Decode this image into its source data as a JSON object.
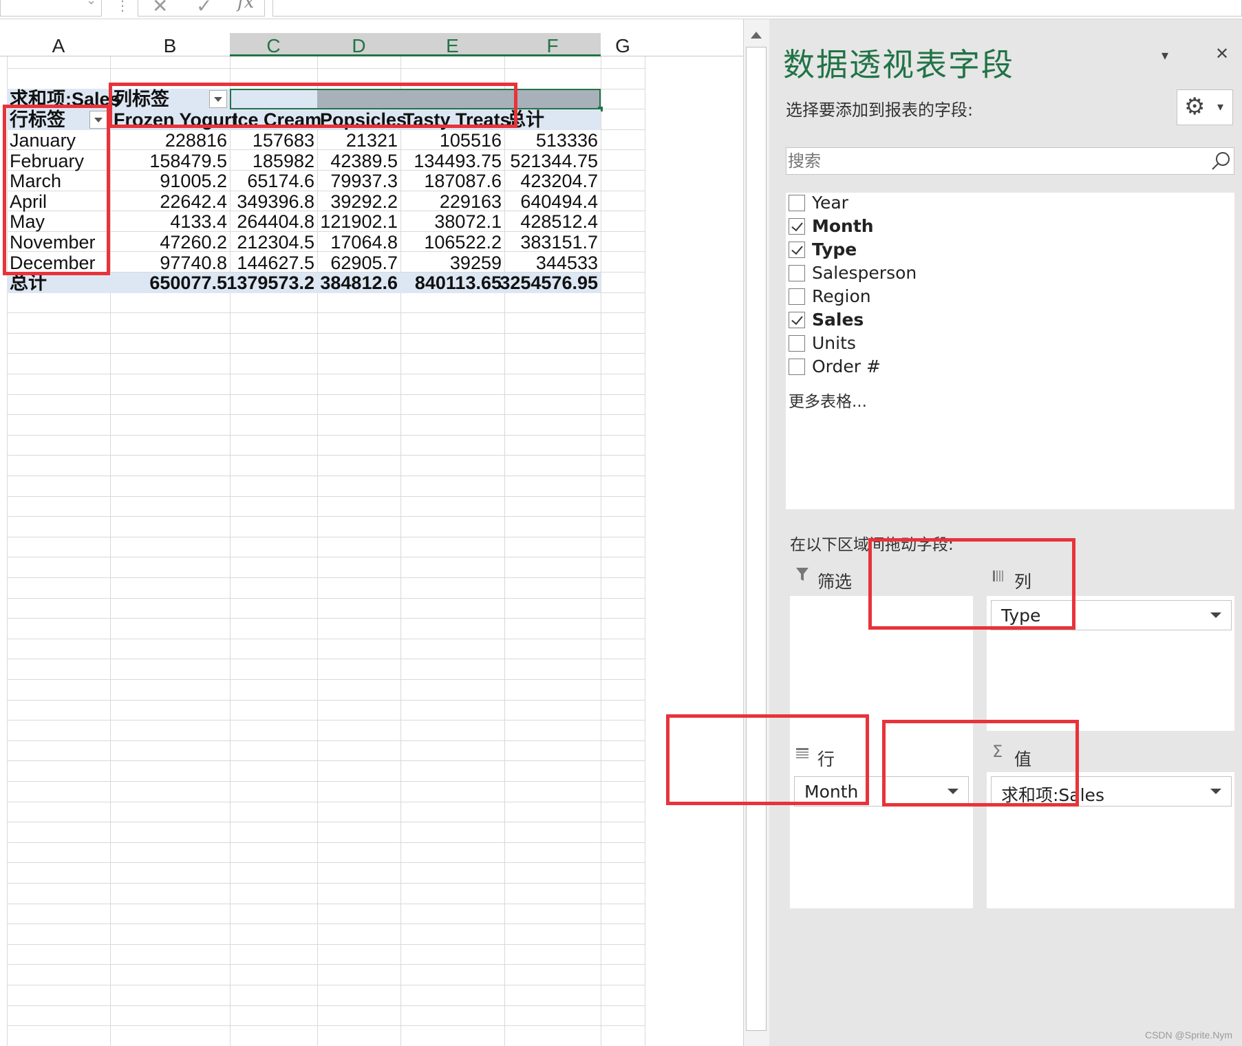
{
  "formula_bar": {
    "fx_label": "fx"
  },
  "columns": [
    "A",
    "B",
    "C",
    "D",
    "E",
    "F",
    "G"
  ],
  "pivot": {
    "values_label": "求和项:Sales",
    "column_labels": "列标签",
    "row_labels": "行标签",
    "col_headers": [
      "Frozen Yogurt",
      "Ice Cream",
      "Popsicles",
      "Tasty Treats",
      "总计"
    ],
    "rows": [
      {
        "label": "January",
        "values": [
          "228816",
          "157683",
          "21321",
          "105516",
          "513336"
        ]
      },
      {
        "label": "February",
        "values": [
          "158479.5",
          "185982",
          "42389.5",
          "134493.75",
          "521344.75"
        ]
      },
      {
        "label": "March",
        "values": [
          "91005.2",
          "65174.6",
          "79937.3",
          "187087.6",
          "423204.7"
        ]
      },
      {
        "label": "April",
        "values": [
          "22642.4",
          "349396.8",
          "39292.2",
          "229163",
          "640494.4"
        ]
      },
      {
        "label": "May",
        "values": [
          "4133.4",
          "264404.8",
          "121902.1",
          "38072.1",
          "428512.4"
        ]
      },
      {
        "label": "November",
        "values": [
          "47260.2",
          "212304.5",
          "17064.8",
          "106522.2",
          "383151.7"
        ]
      },
      {
        "label": "December",
        "values": [
          "97740.8",
          "144627.5",
          "62905.7",
          "39259",
          "344533"
        ]
      }
    ],
    "total": {
      "label": "总计",
      "values": [
        "650077.5",
        "1379573.2",
        "384812.6",
        "840113.65",
        "3254576.95"
      ]
    }
  },
  "pane": {
    "title": "数据透视表字段",
    "subtitle": "选择要添加到报表的字段:",
    "search_placeholder": "搜索",
    "fields": [
      {
        "label": "Year",
        "checked": false
      },
      {
        "label": "Month",
        "checked": true
      },
      {
        "label": "Type",
        "checked": true
      },
      {
        "label": "Salesperson",
        "checked": false
      },
      {
        "label": "Region",
        "checked": false
      },
      {
        "label": "Sales",
        "checked": true
      },
      {
        "label": "Units",
        "checked": false
      },
      {
        "label": "Order #",
        "checked": false
      }
    ],
    "more_tables": "更多表格...",
    "drag_hint": "在以下区域间拖动字段:",
    "areas": {
      "filter": {
        "label": "筛选"
      },
      "columns": {
        "label": "列",
        "item": "Type"
      },
      "rows": {
        "label": "行",
        "item": "Month"
      },
      "values": {
        "label": "值",
        "item": "求和项:Sales"
      }
    }
  },
  "watermark": "CSDN @Sprite.Nym",
  "colors": {
    "accent": "#217346",
    "highlight": "#e8333a",
    "pivot_header": "#dde7f4"
  }
}
